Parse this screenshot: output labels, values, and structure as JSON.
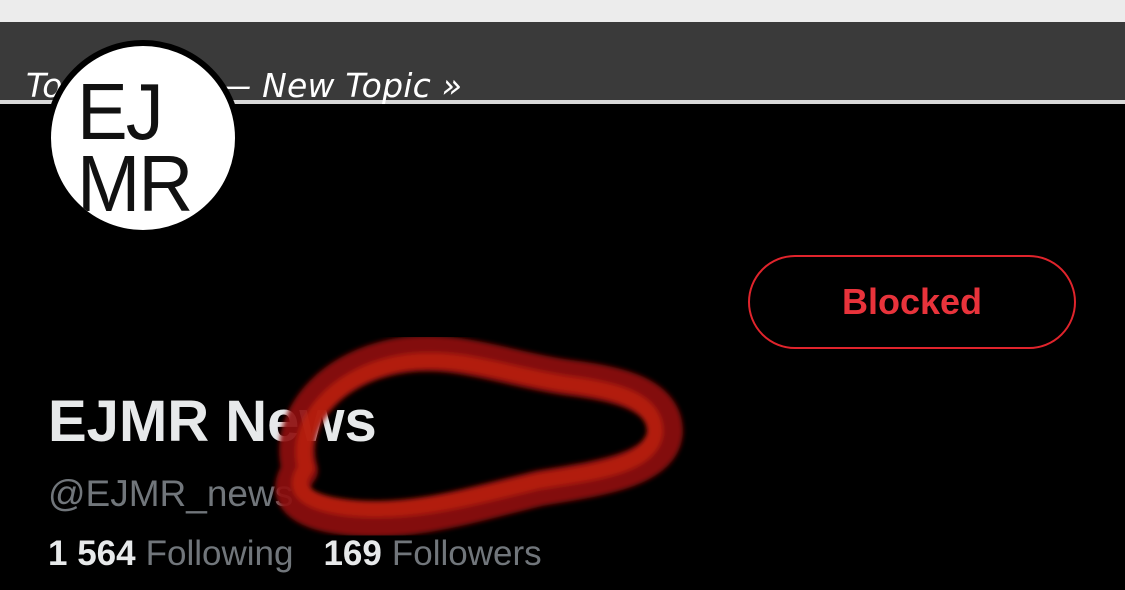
{
  "topic_bar": {
    "text": "Topic Filter — New Topic »"
  },
  "avatar": {
    "logo_line1": "EJ",
    "logo_line2": "MR"
  },
  "profile": {
    "display_name": "EJMR News",
    "handle": "@EJMR_news",
    "following_count": "1 564",
    "following_label": "Following",
    "followers_count": "169",
    "followers_label": "Followers",
    "blocked_label": "Blocked"
  },
  "colors": {
    "background": "#000000",
    "topic_bar": "#3a3a3a",
    "blocked_accent": "#e0242c",
    "annotation": "#b0180e"
  }
}
